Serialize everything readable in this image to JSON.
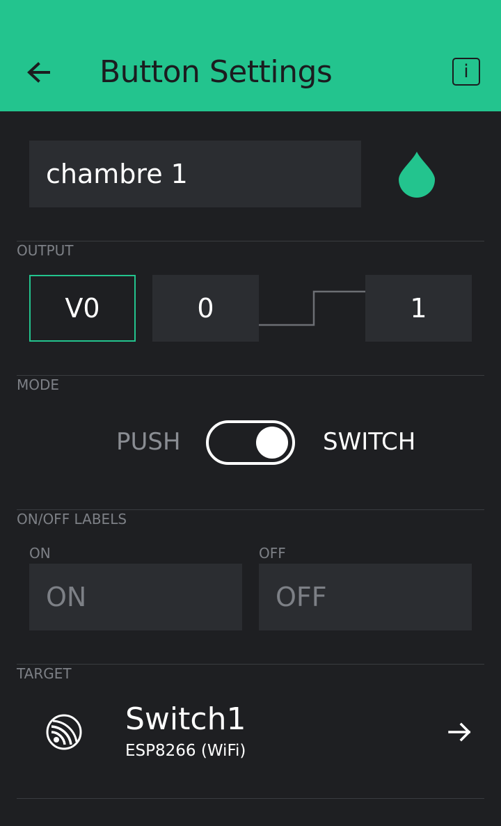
{
  "header": {
    "title": "Button Settings",
    "info_label": "i",
    "back_icon": "arrow-left-icon",
    "background_color": "#23c48e"
  },
  "widget": {
    "name": "chambre 1",
    "color": "#23c48e",
    "color_icon": "droplet-icon"
  },
  "output": {
    "section_label": "OUTPUT",
    "pin": "V0",
    "low_value": "0",
    "high_value": "1"
  },
  "mode": {
    "section_label": "MODE",
    "push_label": "PUSH",
    "switch_label": "SWITCH",
    "selected": "SWITCH"
  },
  "labels": {
    "section_label": "ON/OFF LABELS",
    "on_caption": "ON",
    "off_caption": "OFF",
    "on_placeholder": "ON",
    "off_placeholder": "OFF"
  },
  "target": {
    "section_label": "TARGET",
    "device_name": "Switch1",
    "device_type": "ESP8266 (WiFi)",
    "device_icon": "espressif-icon",
    "arrow_icon": "arrow-right-icon"
  }
}
